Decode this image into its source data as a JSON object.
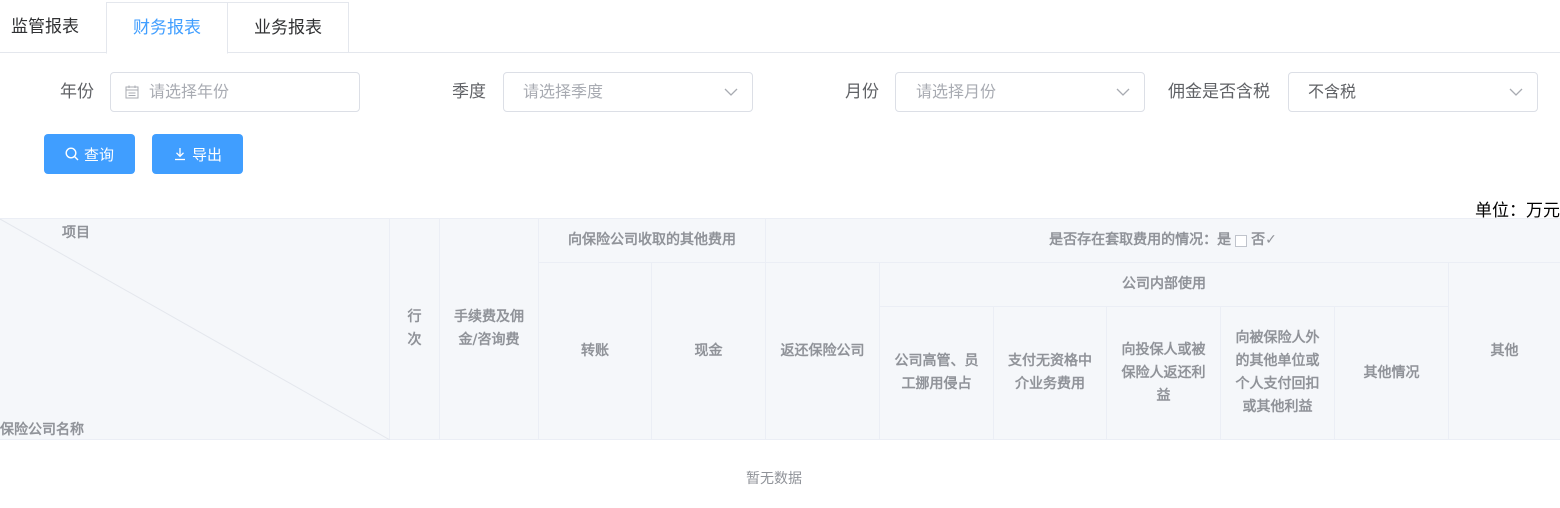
{
  "tabs": [
    {
      "label": "监管报表"
    },
    {
      "label": "财务报表"
    },
    {
      "label": "业务报表"
    }
  ],
  "filters": {
    "year": {
      "label": "年份",
      "placeholder": "请选择年份",
      "icon": "calendar-icon"
    },
    "quarter": {
      "label": "季度",
      "placeholder": "请选择季度",
      "icon": "chevron-down-icon"
    },
    "month": {
      "label": "月份",
      "placeholder": "请选择月份",
      "icon": "chevron-down-icon"
    },
    "tax": {
      "label": "佣金是否含税",
      "value": "不含税",
      "icon": "chevron-down-icon"
    }
  },
  "buttons": {
    "query": {
      "label": "查询",
      "icon": "search-icon"
    },
    "export": {
      "label": "导出",
      "icon": "download-icon"
    }
  },
  "unit_label": "单位：万元",
  "table": {
    "corner_top": "项目",
    "corner_bottom": "保险公司名称",
    "row_no": "行次",
    "commission": "手续费及佣金/咨询费",
    "other_fees_group": "向保险公司收取的其他费用",
    "transfer": "转账",
    "cash": "现金",
    "cashing_group_prefix": "是否存在套取费用的情况：是",
    "cashing_group_no": "否✓",
    "return_company": "返还保险公司",
    "internal_group": "公司内部使用",
    "internal_cols": [
      "公司高管、员工挪用侵占",
      "支付无资格中介业务费用",
      "向投保人或被保险人返还利益",
      "向被保险人外的其他单位或个人支付回扣或其他利益",
      "其他情况"
    ],
    "other": "其他",
    "empty_text": "暂无数据"
  },
  "colors": {
    "primary": "#409eff",
    "header_bg": "#f5f7fa",
    "border": "#ebeef5"
  }
}
